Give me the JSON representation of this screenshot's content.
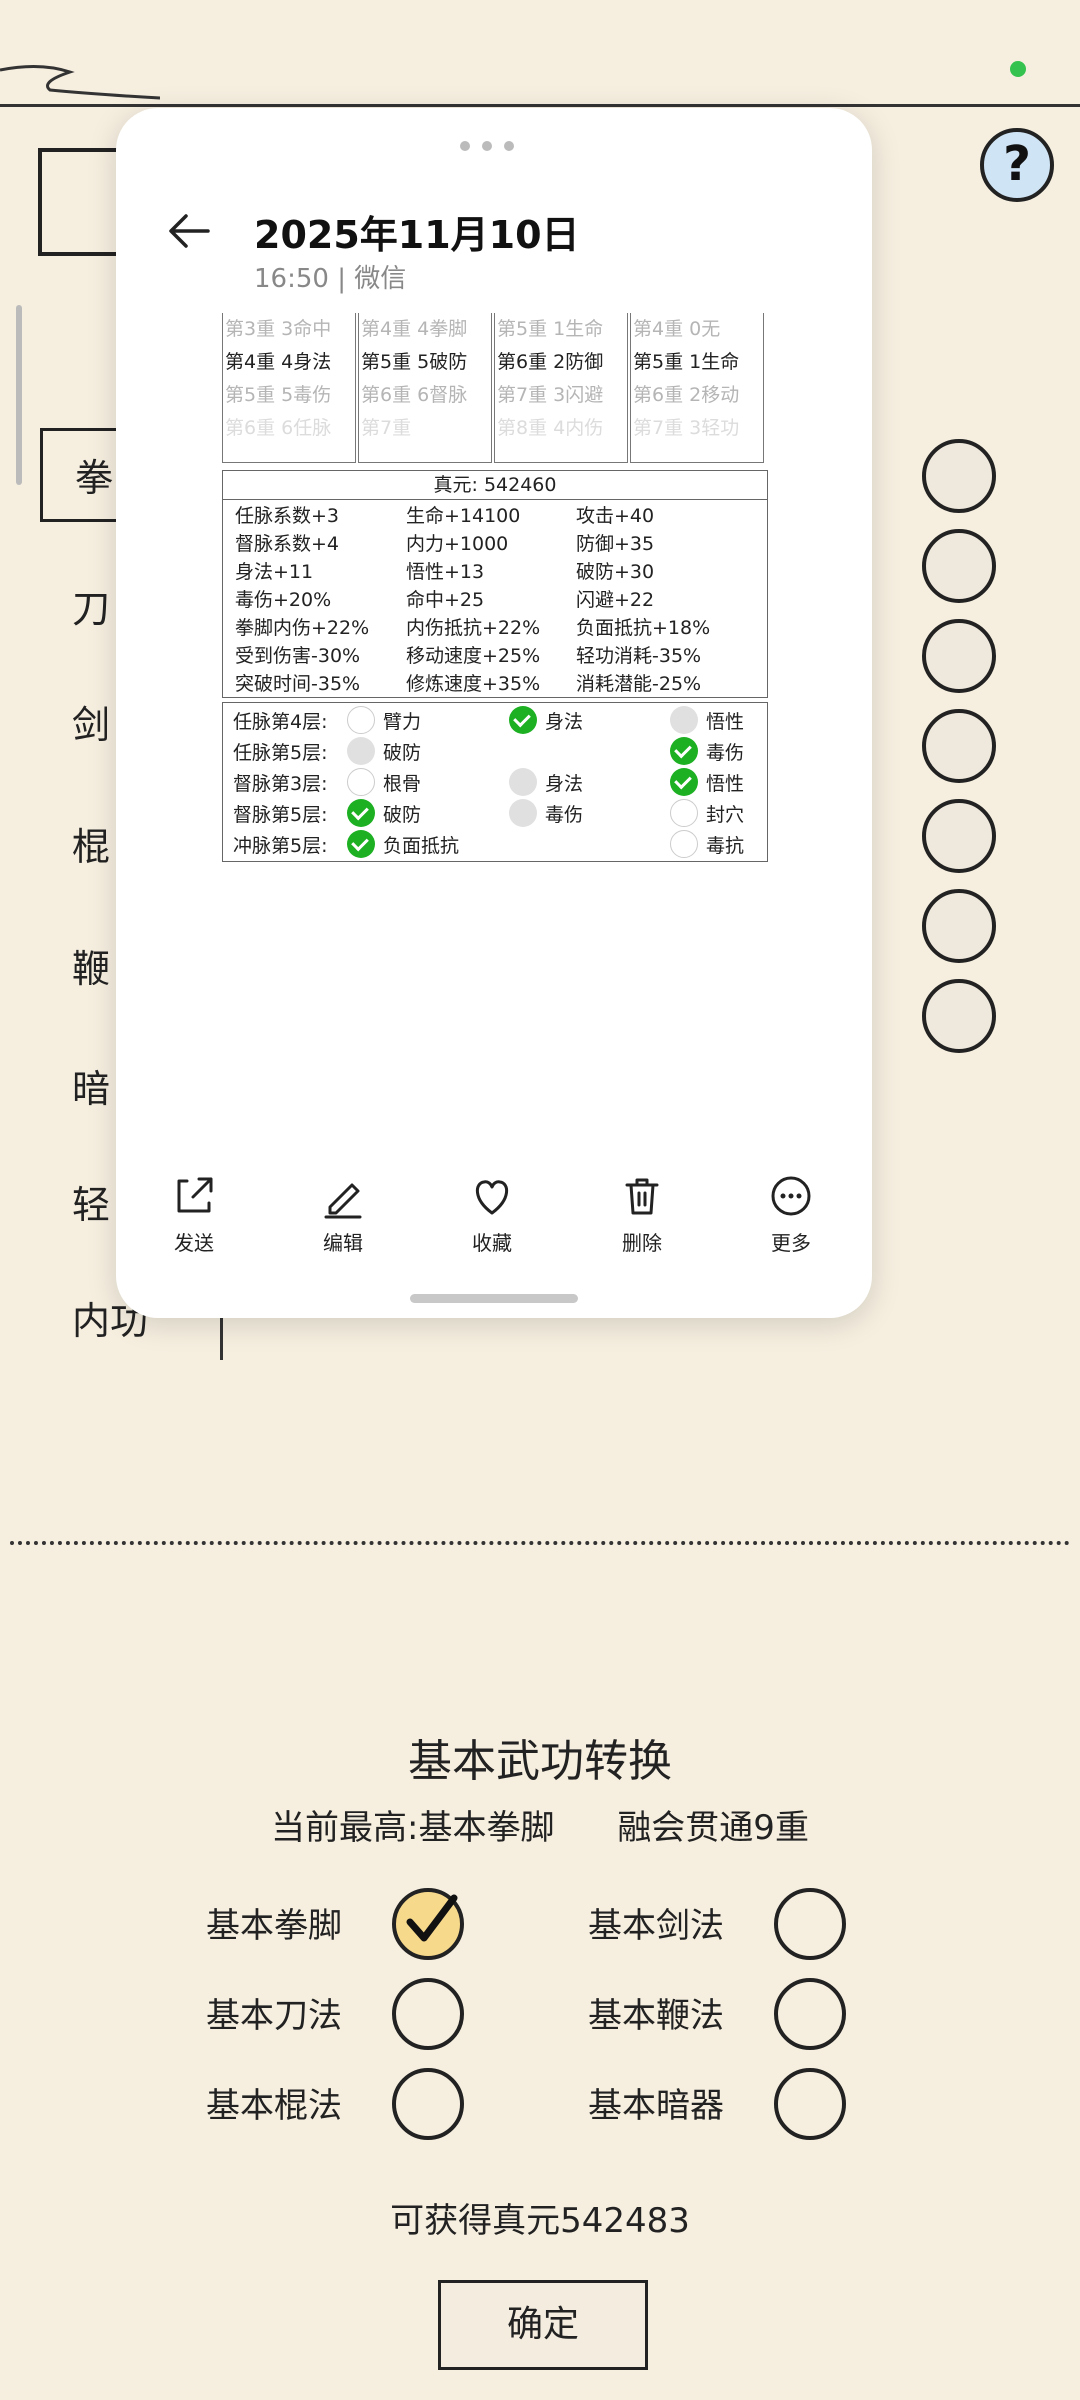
{
  "help": {
    "label": "?"
  },
  "categories": [
    "拳",
    "刀",
    "剑",
    "棍",
    "鞭",
    "暗",
    "轻",
    "内功"
  ],
  "conversion": {
    "title": "基本武功转换",
    "current_highest": "当前最高:基本拳脚",
    "mastery": "融会贯通9重",
    "options": [
      {
        "label": "基本拳脚",
        "checked": true
      },
      {
        "label": "基本剑法",
        "checked": false
      },
      {
        "label": "基本刀法",
        "checked": false
      },
      {
        "label": "基本鞭法",
        "checked": false
      },
      {
        "label": "基本棍法",
        "checked": false
      },
      {
        "label": "基本暗器",
        "checked": false
      }
    ],
    "reward": "可获得真元542483",
    "confirm": "确定"
  },
  "viewer": {
    "date": "2025年11月10日",
    "meta": "16:50 | 微信",
    "screenshot": {
      "columns": [
        {
          "rows": [
            {
              "t": "第3重  3命中",
              "s": "dim"
            },
            {
              "t": "第4重  4身法",
              "s": "bold"
            },
            {
              "t": "第5重  5毒伤",
              "s": "dim"
            },
            {
              "t": "第6重  6任脉",
              "s": "dim"
            }
          ]
        },
        {
          "rows": [
            {
              "t": "第4重  4拳脚",
              "s": "dim"
            },
            {
              "t": "第5重  5破防",
              "s": "bold"
            },
            {
              "t": "第6重  6督脉",
              "s": "dim"
            },
            {
              "t": "第7重",
              "s": "dim"
            }
          ]
        },
        {
          "rows": [
            {
              "t": "第5重  1生命",
              "s": "dim"
            },
            {
              "t": "第6重  2防御",
              "s": "bold"
            },
            {
              "t": "第7重  3闪避",
              "s": "dim"
            },
            {
              "t": "第8重  4内伤",
              "s": "dim"
            }
          ]
        },
        {
          "rows": [
            {
              "t": "第4重  0无",
              "s": "dim"
            },
            {
              "t": "第5重  1生命",
              "s": "bold"
            },
            {
              "t": "第6重  2移动",
              "s": "dim"
            },
            {
              "t": "第7重  3轻功",
              "s": "dim"
            }
          ]
        }
      ],
      "zhenyuan": "真元: 542460",
      "stats": [
        [
          "任脉系数+3",
          "生命+14100",
          "攻击+40"
        ],
        [
          "督脉系数+4",
          "内力+1000",
          "防御+35"
        ],
        [
          "身法+11",
          "悟性+13",
          "破防+30"
        ],
        [
          "毒伤+20%",
          "命中+25",
          "闪避+22"
        ],
        [
          "拳脚内伤+22%",
          "内伤抵抗+22%",
          "负面抵抗+18%"
        ],
        [
          "受到伤害-30%",
          "移动速度+25%",
          "轻功消耗-35%"
        ],
        [
          "突破时间-35%",
          "修炼速度+35%",
          "消耗潜能-25%"
        ]
      ],
      "meridians": [
        {
          "label": "任脉第4层:",
          "opts": [
            {
              "t": "臂力",
              "s": "e"
            },
            {
              "t": "身法",
              "s": "g"
            },
            {
              "t": "悟性",
              "s": "x"
            }
          ]
        },
        {
          "label": "任脉第5层:",
          "opts": [
            {
              "t": "破防",
              "s": "x"
            },
            {
              "t": "",
              "s": ""
            },
            {
              "t": "毒伤",
              "s": "g"
            }
          ]
        },
        {
          "label": "督脉第3层:",
          "opts": [
            {
              "t": "根骨",
              "s": "e"
            },
            {
              "t": "身法",
              "s": "x"
            },
            {
              "t": "悟性",
              "s": "g"
            }
          ]
        },
        {
          "label": "督脉第5层:",
          "opts": [
            {
              "t": "破防",
              "s": "g"
            },
            {
              "t": "毒伤",
              "s": "x"
            },
            {
              "t": "封穴",
              "s": "e"
            }
          ]
        },
        {
          "label": "冲脉第5层:",
          "opts": [
            {
              "t": "负面抵抗",
              "s": "g"
            },
            {
              "t": "",
              "s": ""
            },
            {
              "t": "毒抗",
              "s": "e"
            }
          ]
        }
      ]
    },
    "actions": [
      {
        "label": "发送",
        "icon": "share-icon"
      },
      {
        "label": "编辑",
        "icon": "edit-icon"
      },
      {
        "label": "收藏",
        "icon": "heart-icon"
      },
      {
        "label": "删除",
        "icon": "trash-icon"
      },
      {
        "label": "更多",
        "icon": "more-icon"
      }
    ]
  }
}
